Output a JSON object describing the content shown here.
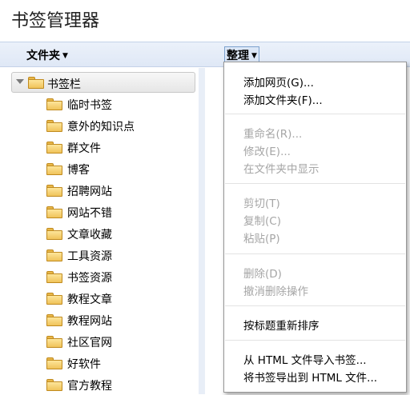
{
  "app": {
    "title": "书签管理器"
  },
  "toolbar": {
    "folders_label": "文件夹",
    "organize_label": "整理"
  },
  "tree": {
    "root": "书签栏",
    "items": [
      "临时书签",
      "意外的知识点",
      "群文件",
      "博客",
      "招聘网站",
      "网站不错",
      "文章收藏",
      "工具资源",
      "书签资源",
      "教程文章",
      "教程网站",
      "社区官网",
      "好软件",
      "官方教程"
    ]
  },
  "menu": {
    "add_page": "添加网页(G)...",
    "add_folder": "添加文件夹(F)...",
    "rename": "重命名(R)...",
    "edit": "修改(E)...",
    "show_in_folder": "在文件夹中显示",
    "cut": "剪切(T)",
    "copy": "复制(C)",
    "paste": "粘贴(P)",
    "delete": "删除(D)",
    "undo_delete": "撤消删除操作",
    "sort_by_title": "按标题重新排序",
    "import_html": "从 HTML 文件导入书签...",
    "export_html": "将书签导出到 HTML 文件..."
  }
}
